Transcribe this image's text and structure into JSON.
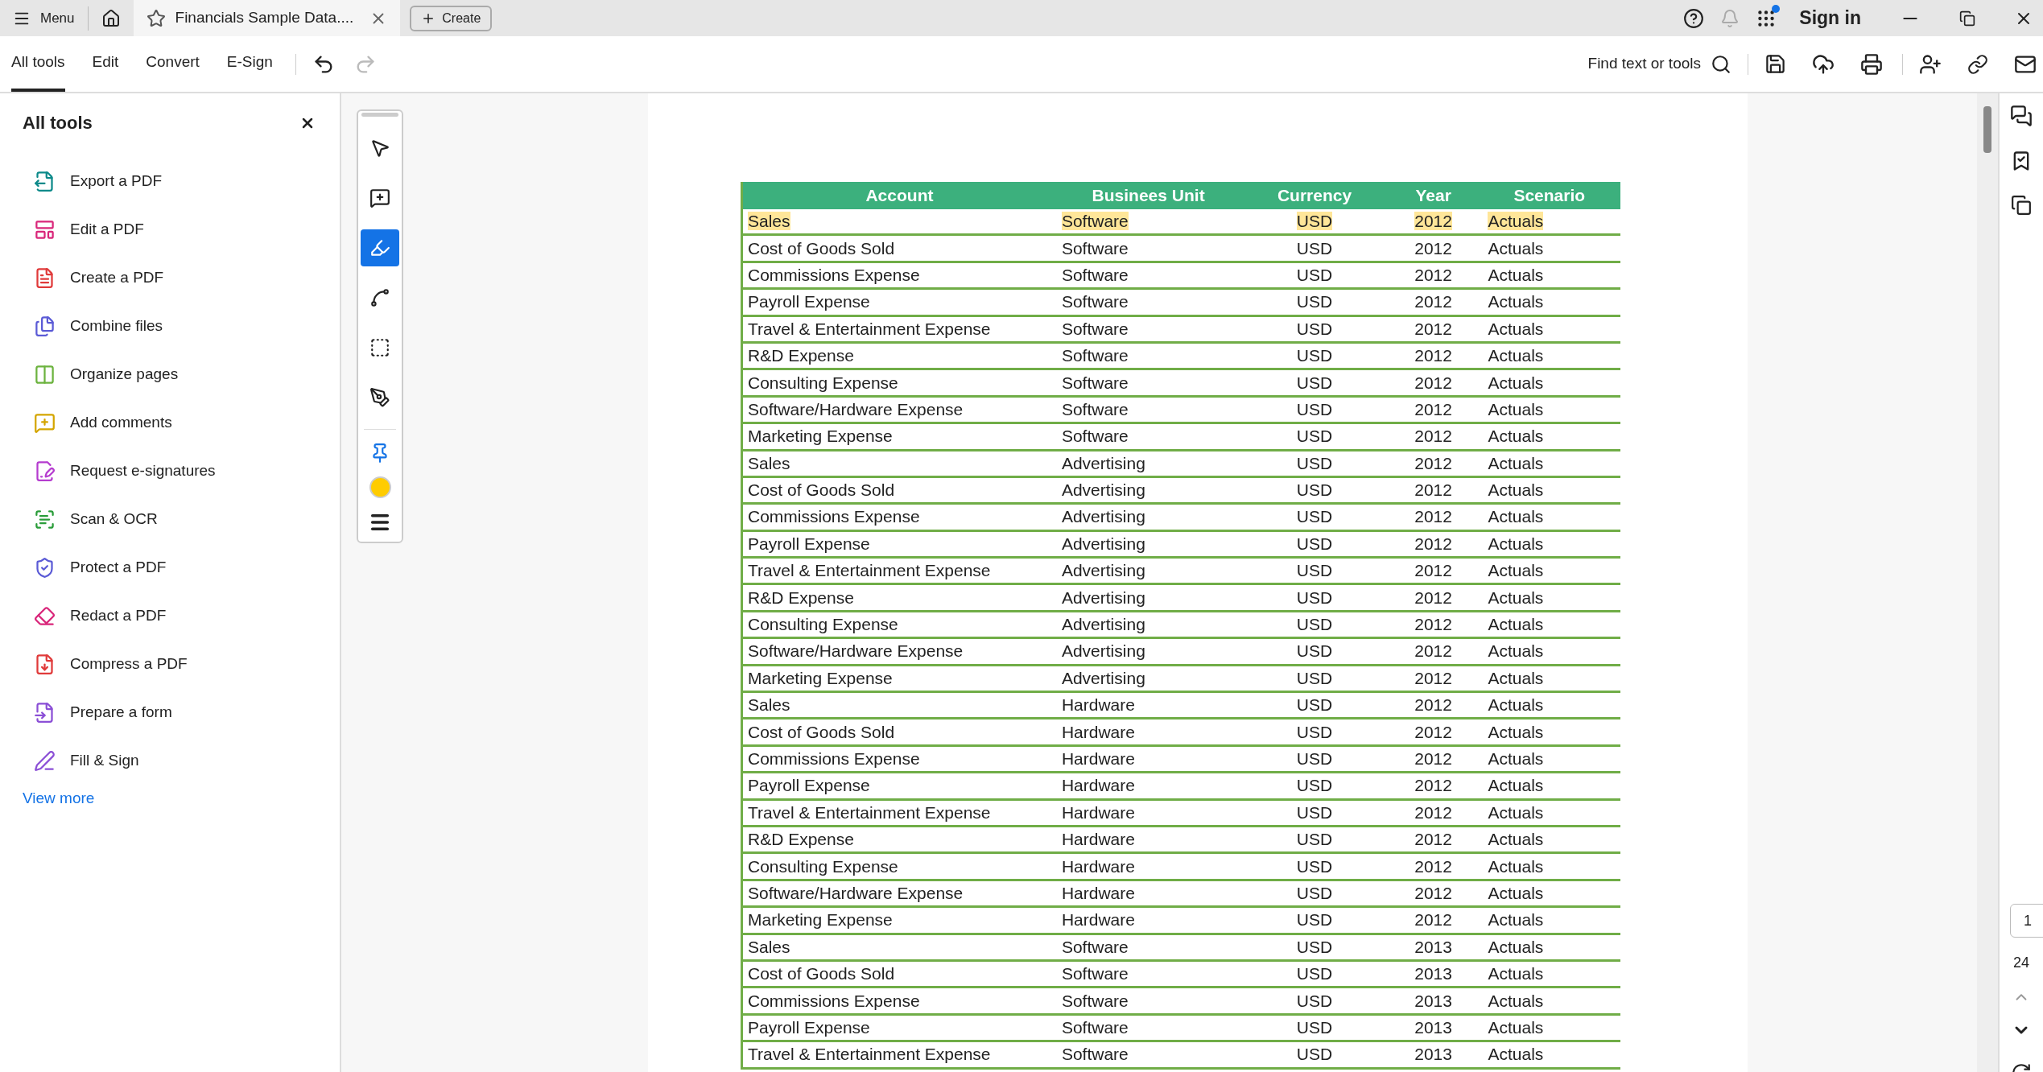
{
  "title_bar": {
    "menu_label": "Menu",
    "tab_title": "Financials Sample Data....",
    "create_label": "Create",
    "sign_in": "Sign in"
  },
  "toolbar": {
    "tabs": [
      {
        "label": "All tools",
        "selected": true
      },
      {
        "label": "Edit",
        "selected": false
      },
      {
        "label": "Convert",
        "selected": false
      },
      {
        "label": "E-Sign",
        "selected": false
      }
    ],
    "undo_disabled": false,
    "redo_disabled": true,
    "search_label": "Find text or tools"
  },
  "tools_panel": {
    "title": "All tools",
    "items": [
      {
        "kind": "export",
        "label": "Export a PDF"
      },
      {
        "kind": "edit",
        "label": "Edit a PDF"
      },
      {
        "kind": "create",
        "label": "Create a PDF"
      },
      {
        "kind": "combine",
        "label": "Combine files"
      },
      {
        "kind": "organize",
        "label": "Organize pages"
      },
      {
        "kind": "comment",
        "label": "Add comments"
      },
      {
        "kind": "esign",
        "label": "Request e-signatures"
      },
      {
        "kind": "scan",
        "label": "Scan & OCR"
      },
      {
        "kind": "protect",
        "label": "Protect a PDF"
      },
      {
        "kind": "redact",
        "label": "Redact a PDF"
      },
      {
        "kind": "compress",
        "label": "Compress a PDF"
      },
      {
        "kind": "form",
        "label": "Prepare a form"
      },
      {
        "kind": "fill",
        "label": "Fill & Sign"
      }
    ],
    "view_more": "View more"
  },
  "quick_tools": [
    {
      "kind": "select",
      "selected": false
    },
    {
      "kind": "comment",
      "selected": false
    },
    {
      "kind": "highlight",
      "selected": true
    },
    {
      "kind": "draw",
      "selected": false
    },
    {
      "kind": "text",
      "selected": false
    },
    {
      "kind": "sign",
      "selected": false
    }
  ],
  "page_nav": {
    "current_page": "1",
    "page_count": "24"
  },
  "table": {
    "columns": [
      "Account",
      "Businees Unit",
      "Currency",
      "Year",
      "Scenario"
    ],
    "rows": [
      {
        "highlighted": true,
        "cells": [
          "Sales",
          "Software",
          "USD",
          "2012",
          "Actuals"
        ]
      },
      {
        "highlighted": false,
        "cells": [
          "Cost of Goods Sold",
          "Software",
          "USD",
          "2012",
          "Actuals"
        ]
      },
      {
        "highlighted": false,
        "cells": [
          "Commissions Expense",
          "Software",
          "USD",
          "2012",
          "Actuals"
        ]
      },
      {
        "highlighted": false,
        "cells": [
          "Payroll Expense",
          "Software",
          "USD",
          "2012",
          "Actuals"
        ]
      },
      {
        "highlighted": false,
        "cells": [
          "Travel & Entertainment Expense",
          "Software",
          "USD",
          "2012",
          "Actuals"
        ]
      },
      {
        "highlighted": false,
        "cells": [
          "R&D Expense",
          "Software",
          "USD",
          "2012",
          "Actuals"
        ]
      },
      {
        "highlighted": false,
        "cells": [
          "Consulting Expense",
          "Software",
          "USD",
          "2012",
          "Actuals"
        ]
      },
      {
        "highlighted": false,
        "cells": [
          "Software/Hardware Expense",
          "Software",
          "USD",
          "2012",
          "Actuals"
        ]
      },
      {
        "highlighted": false,
        "cells": [
          "Marketing Expense",
          "Software",
          "USD",
          "2012",
          "Actuals"
        ]
      },
      {
        "highlighted": false,
        "cells": [
          "Sales",
          "Advertising",
          "USD",
          "2012",
          "Actuals"
        ]
      },
      {
        "highlighted": false,
        "cells": [
          "Cost of Goods Sold",
          "Advertising",
          "USD",
          "2012",
          "Actuals"
        ]
      },
      {
        "highlighted": false,
        "cells": [
          "Commissions Expense",
          "Advertising",
          "USD",
          "2012",
          "Actuals"
        ]
      },
      {
        "highlighted": false,
        "cells": [
          "Payroll Expense",
          "Advertising",
          "USD",
          "2012",
          "Actuals"
        ]
      },
      {
        "highlighted": false,
        "cells": [
          "Travel & Entertainment Expense",
          "Advertising",
          "USD",
          "2012",
          "Actuals"
        ]
      },
      {
        "highlighted": false,
        "cells": [
          "R&D Expense",
          "Advertising",
          "USD",
          "2012",
          "Actuals"
        ]
      },
      {
        "highlighted": false,
        "cells": [
          "Consulting Expense",
          "Advertising",
          "USD",
          "2012",
          "Actuals"
        ]
      },
      {
        "highlighted": false,
        "cells": [
          "Software/Hardware Expense",
          "Advertising",
          "USD",
          "2012",
          "Actuals"
        ]
      },
      {
        "highlighted": false,
        "cells": [
          "Marketing Expense",
          "Advertising",
          "USD",
          "2012",
          "Actuals"
        ]
      },
      {
        "highlighted": false,
        "cells": [
          "Sales",
          "Hardware",
          "USD",
          "2012",
          "Actuals"
        ]
      },
      {
        "highlighted": false,
        "cells": [
          "Cost of Goods Sold",
          "Hardware",
          "USD",
          "2012",
          "Actuals"
        ]
      },
      {
        "highlighted": false,
        "cells": [
          "Commissions Expense",
          "Hardware",
          "USD",
          "2012",
          "Actuals"
        ]
      },
      {
        "highlighted": false,
        "cells": [
          "Payroll Expense",
          "Hardware",
          "USD",
          "2012",
          "Actuals"
        ]
      },
      {
        "highlighted": false,
        "cells": [
          "Travel & Entertainment Expense",
          "Hardware",
          "USD",
          "2012",
          "Actuals"
        ]
      },
      {
        "highlighted": false,
        "cells": [
          "R&D Expense",
          "Hardware",
          "USD",
          "2012",
          "Actuals"
        ]
      },
      {
        "highlighted": false,
        "cells": [
          "Consulting Expense",
          "Hardware",
          "USD",
          "2012",
          "Actuals"
        ]
      },
      {
        "highlighted": false,
        "cells": [
          "Software/Hardware Expense",
          "Hardware",
          "USD",
          "2012",
          "Actuals"
        ]
      },
      {
        "highlighted": false,
        "cells": [
          "Marketing Expense",
          "Hardware",
          "USD",
          "2012",
          "Actuals"
        ]
      },
      {
        "highlighted": false,
        "cells": [
          "Sales",
          "Software",
          "USD",
          "2013",
          "Actuals"
        ]
      },
      {
        "highlighted": false,
        "cells": [
          "Cost of Goods Sold",
          "Software",
          "USD",
          "2013",
          "Actuals"
        ]
      },
      {
        "highlighted": false,
        "cells": [
          "Commissions Expense",
          "Software",
          "USD",
          "2013",
          "Actuals"
        ]
      },
      {
        "highlighted": false,
        "cells": [
          "Payroll Expense",
          "Software",
          "USD",
          "2013",
          "Actuals"
        ]
      },
      {
        "highlighted": false,
        "cells": [
          "Travel & Entertainment Expense",
          "Software",
          "USD",
          "2013",
          "Actuals"
        ]
      }
    ]
  }
}
